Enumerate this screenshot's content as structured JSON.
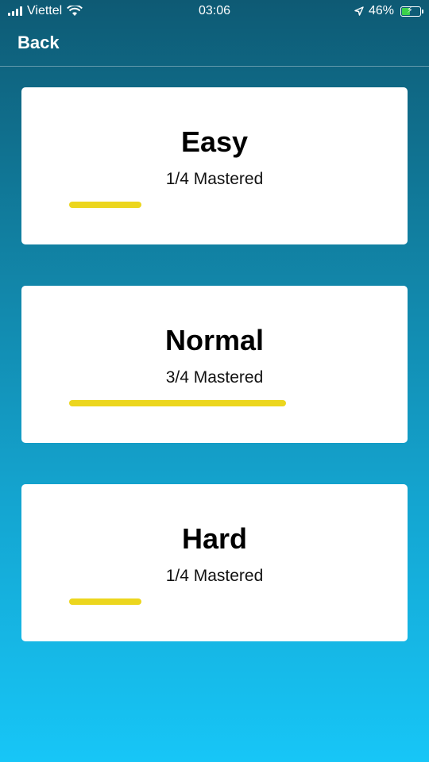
{
  "status_bar": {
    "carrier": "Viettel",
    "time": "03:06",
    "battery_percent": "46%",
    "battery_level": 0.46,
    "signal_icon": "signal-bars-icon",
    "wifi_icon": "wifi-icon",
    "location_icon": "location-arrow-icon",
    "battery_icon": "battery-charging-icon"
  },
  "nav": {
    "back_label": "Back"
  },
  "levels": [
    {
      "title": "Easy",
      "progress_text": "1/4 Mastered",
      "progress": 0.25
    },
    {
      "title": "Normal",
      "progress_text": "3/4 Mastered",
      "progress": 0.75
    },
    {
      "title": "Hard",
      "progress_text": "1/4 Mastered",
      "progress": 0.25
    }
  ],
  "colors": {
    "progress_bar": "#ecd61e",
    "gradient_top": "#0e5a74",
    "gradient_bottom": "#17c6f7",
    "card_background": "#ffffff"
  }
}
